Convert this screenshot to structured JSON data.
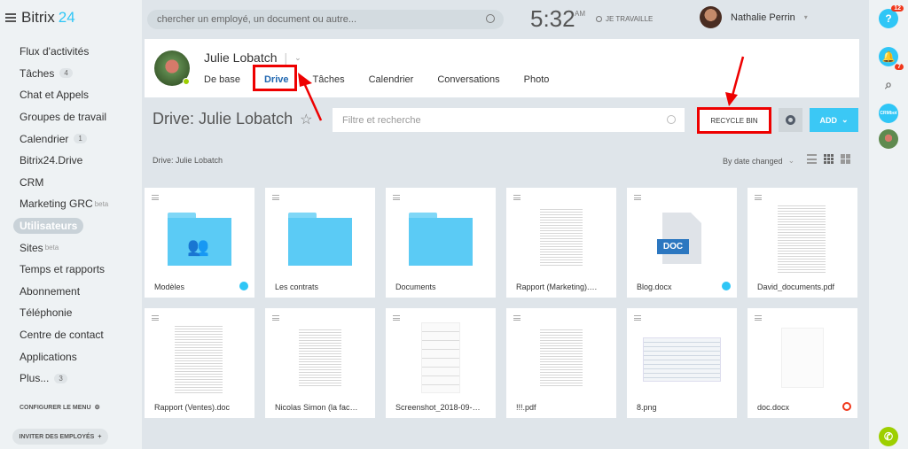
{
  "app": {
    "logo_text": "Bitrix",
    "logo_num": "24"
  },
  "sidebar": {
    "items": [
      {
        "label": "Flux d'activités"
      },
      {
        "label": "Tâches",
        "badge": "4"
      },
      {
        "label": "Chat et Appels"
      },
      {
        "label": "Groupes de travail"
      },
      {
        "label": "Calendrier",
        "badge": "1"
      },
      {
        "label": "Bitrix24.Drive"
      },
      {
        "label": "CRM"
      },
      {
        "label": "Marketing GRC",
        "sup": "beta"
      },
      {
        "label": "Utilisateurs",
        "active": true
      },
      {
        "label": "Sites",
        "sup": "beta"
      },
      {
        "label": "Temps et rapports"
      },
      {
        "label": "Abonnement"
      },
      {
        "label": "Téléphonie"
      },
      {
        "label": "Centre de contact"
      },
      {
        "label": "Applications"
      },
      {
        "label": "Plus...",
        "badge": "3"
      }
    ],
    "configure": "CONFIGURER LE MENU",
    "invite": "INVITER DES EMPLOYÉS"
  },
  "header": {
    "search_placeholder": "chercher un employé, un document ou autre...",
    "time": "5:32",
    "ampm": "AM",
    "work_status": "JE TRAVAILLE",
    "user_name": "Nathalie Perrin"
  },
  "rail": {
    "help_badge": "12",
    "notif_badge": "7",
    "crm_label": "CRMbot"
  },
  "profile": {
    "name": "Julie Lobatch",
    "tabs": [
      "De base",
      "Drive",
      "Tâches",
      "Calendrier",
      "Conversations",
      "Photo"
    ],
    "active_tab": "Drive"
  },
  "drive": {
    "title": "Drive: Julie Lobatch",
    "filter_placeholder": "Filtre et recherche",
    "recycle_label": "RECYCLE BIN",
    "add_label": "ADD",
    "breadcrumb": "Drive: Julie Lobatch",
    "sort_label": "By date changed"
  },
  "files": [
    {
      "name": "Modèles",
      "kind": "folder-shared",
      "badge": "shared"
    },
    {
      "name": "Les contrats",
      "kind": "folder"
    },
    {
      "name": "Documents",
      "kind": "folder"
    },
    {
      "name": "Rapport (Marketing).doc",
      "kind": "doc"
    },
    {
      "name": "Blog.docx",
      "kind": "docx",
      "badge": "shared",
      "icon_text": "DOC"
    },
    {
      "name": "David_documents.pdf",
      "kind": "doc"
    },
    {
      "name": "Rapport (Ventes).doc",
      "kind": "doc"
    },
    {
      "name": "Nicolas Simon (la facture...",
      "kind": "doc"
    },
    {
      "name": "Screenshot_2018-09-10-0...",
      "kind": "screenshot"
    },
    {
      "name": "!!!.pdf",
      "kind": "doc"
    },
    {
      "name": "8.png",
      "kind": "png"
    },
    {
      "name": "doc.docx",
      "kind": "blank",
      "badge": "blocked"
    }
  ],
  "colors": {
    "accent": "#3bc8f5",
    "highlight": "#ee0000",
    "active_tab": "#2067b0"
  }
}
